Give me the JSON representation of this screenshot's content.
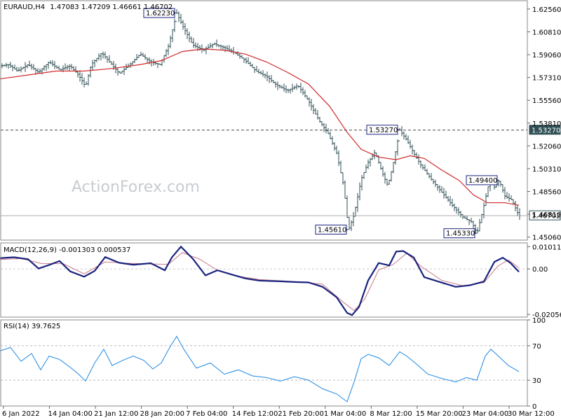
{
  "chart_data": [
    {
      "type": "candlestick-ohlc",
      "panel": "price",
      "symbol": "EURAUD,H4",
      "header_values": "1.47083 1.47209 1.46661 1.46702",
      "watermark": "ActionForex.com",
      "ylim": [
        1.4483,
        1.632
      ],
      "y_ticks": [
        "1.62560",
        "1.60810",
        "1.59060",
        "1.57310",
        "1.55560",
        "1.53810",
        "1.52060",
        "1.50310",
        "1.48560",
        "1.46810",
        "1.45060"
      ],
      "x_ticks": [
        "6 Jan 2022",
        "14 Jan 04:00",
        "21 Jan 12:00",
        "28 Jan 20:00",
        "7 Feb 04:00",
        "14 Feb 12:00",
        "21 Feb 20:00",
        "1 Mar 04:00",
        "8 Mar 12:00",
        "15 Mar 20:00",
        "23 Mar 04:00",
        "30 Mar 12:00"
      ],
      "price_path": [
        [
          0,
          1.582
        ],
        [
          12,
          1.583
        ],
        [
          25,
          1.578
        ],
        [
          40,
          1.583
        ],
        [
          55,
          1.577
        ],
        [
          70,
          1.585
        ],
        [
          85,
          1.579
        ],
        [
          100,
          1.582
        ],
        [
          112,
          1.575
        ],
        [
          122,
          1.566
        ],
        [
          130,
          1.583
        ],
        [
          145,
          1.592
        ],
        [
          158,
          1.584
        ],
        [
          170,
          1.576
        ],
        [
          185,
          1.583
        ],
        [
          200,
          1.591
        ],
        [
          215,
          1.585
        ],
        [
          228,
          1.583
        ],
        [
          240,
          1.597
        ],
        [
          252,
          1.6223
        ],
        [
          262,
          1.611
        ],
        [
          275,
          1.598
        ],
        [
          290,
          1.594
        ],
        [
          305,
          1.599
        ],
        [
          320,
          1.596
        ],
        [
          335,
          1.592
        ],
        [
          350,
          1.586
        ],
        [
          365,
          1.578
        ],
        [
          380,
          1.574
        ],
        [
          395,
          1.567
        ],
        [
          410,
          1.563
        ],
        [
          425,
          1.567
        ],
        [
          440,
          1.555
        ],
        [
          455,
          1.54
        ],
        [
          468,
          1.53
        ],
        [
          480,
          1.515
        ],
        [
          490,
          1.49
        ],
        [
          497,
          1.4561
        ],
        [
          505,
          1.468
        ],
        [
          515,
          1.495
        ],
        [
          525,
          1.508
        ],
        [
          535,
          1.516
        ],
        [
          545,
          1.5
        ],
        [
          553,
          1.49
        ],
        [
          560,
          1.505
        ],
        [
          570,
          1.5327
        ],
        [
          580,
          1.525
        ],
        [
          590,
          1.515
        ],
        [
          600,
          1.506
        ],
        [
          615,
          1.495
        ],
        [
          630,
          1.485
        ],
        [
          645,
          1.475
        ],
        [
          660,
          1.466
        ],
        [
          673,
          1.462
        ],
        [
          680,
          1.4533
        ],
        [
          688,
          1.47
        ],
        [
          698,
          1.494
        ],
        [
          705,
          1.489
        ],
        [
          712,
          1.494
        ],
        [
          720,
          1.482
        ],
        [
          730,
          1.479
        ],
        [
          740,
          1.467
        ]
      ],
      "series": [
        {
          "name": "MA",
          "color": "#d0292b",
          "points": [
            [
              0,
              1.572
            ],
            [
              40,
              1.575
            ],
            [
              80,
              1.578
            ],
            [
              120,
              1.578
            ],
            [
              160,
              1.58
            ],
            [
              200,
              1.583
            ],
            [
              230,
              1.586
            ],
            [
              260,
              1.593
            ],
            [
              290,
              1.595
            ],
            [
              320,
              1.594
            ],
            [
              350,
              1.591
            ],
            [
              380,
              1.585
            ],
            [
              410,
              1.577
            ],
            [
              440,
              1.568
            ],
            [
              470,
              1.551
            ],
            [
              495,
              1.531
            ],
            [
              515,
              1.518
            ],
            [
              540,
              1.512
            ],
            [
              565,
              1.51
            ],
            [
              585,
              1.513
            ],
            [
              605,
              1.511
            ],
            [
              630,
              1.502
            ],
            [
              655,
              1.494
            ],
            [
              675,
              1.483
            ],
            [
              695,
              1.477
            ],
            [
              720,
              1.477
            ],
            [
              740,
              1.475
            ]
          ]
        }
      ],
      "horizontal_lines": [
        {
          "value": 1.5327,
          "label": "1.53270",
          "style": "dashed"
        },
        {
          "value": 1.46702,
          "label": "1.46702",
          "style": "solid"
        }
      ],
      "annotations": [
        {
          "text": "1.62230",
          "value": 1.6223,
          "bar": 252
        },
        {
          "text": "1.53270",
          "value": 1.5327,
          "bar": 570
        },
        {
          "text": "1.49400",
          "value": 1.494,
          "bar": 712
        },
        {
          "text": "1.45610",
          "value": 1.4561,
          "bar": 497
        },
        {
          "text": "1.45330",
          "value": 1.4533,
          "bar": 680
        }
      ]
    },
    {
      "type": "line",
      "panel": "macd",
      "title": "MACD(12,26,9) -0.001303 0.000537",
      "ylim": [
        -0.0218,
        0.0118
      ],
      "y_ticks": [
        "0.010113",
        "0.00",
        "-0.020561"
      ],
      "series": [
        {
          "name": "MACD",
          "color": "#1a237e",
          "points": [
            [
              0,
              0.0049
            ],
            [
              20,
              0.0053
            ],
            [
              40,
              0.0044
            ],
            [
              55,
              0.0002
            ],
            [
              70,
              0.0018
            ],
            [
              85,
              0.0036
            ],
            [
              100,
              -0.0011
            ],
            [
              120,
              -0.0035
            ],
            [
              135,
              -0.0009
            ],
            [
              150,
              0.0054
            ],
            [
              170,
              0.0028
            ],
            [
              190,
              0.0019
            ],
            [
              215,
              0.0026
            ],
            [
              235,
              -0.0006
            ],
            [
              245,
              0.0052
            ],
            [
              258,
              0.0101
            ],
            [
              275,
              0.0046
            ],
            [
              293,
              -0.0029
            ],
            [
              310,
              -0.0006
            ],
            [
              330,
              -0.0025
            ],
            [
              350,
              -0.0043
            ],
            [
              370,
              -0.0053
            ],
            [
              400,
              -0.0056
            ],
            [
              420,
              -0.0059
            ],
            [
              440,
              -0.0061
            ],
            [
              460,
              -0.0081
            ],
            [
              480,
              -0.0128
            ],
            [
              495,
              -0.0199
            ],
            [
              502,
              -0.0209
            ],
            [
              512,
              -0.0172
            ],
            [
              525,
              -0.0052
            ],
            [
              540,
              0.0027
            ],
            [
              555,
              0.0016
            ],
            [
              565,
              0.0079
            ],
            [
              575,
              0.0081
            ],
            [
              590,
              0.0052
            ],
            [
              605,
              -0.0037
            ],
            [
              625,
              -0.0057
            ],
            [
              650,
              -0.0081
            ],
            [
              670,
              -0.0074
            ],
            [
              690,
              -0.0057
            ],
            [
              705,
              0.0032
            ],
            [
              717,
              0.0051
            ],
            [
              728,
              0.0027
            ],
            [
              740,
              -0.0013
            ]
          ]
        },
        {
          "name": "Signal",
          "color": "#c87a8a",
          "points": [
            [
              0,
              0.0043
            ],
            [
              30,
              0.0047
            ],
            [
              60,
              0.0024
            ],
            [
              90,
              0.0024
            ],
            [
              120,
              -0.0022
            ],
            [
              150,
              0.0032
            ],
            [
              180,
              0.0026
            ],
            [
              210,
              0.0023
            ],
            [
              240,
              0.0021
            ],
            [
              260,
              0.0074
            ],
            [
              285,
              0.0044
            ],
            [
              310,
              -0.0006
            ],
            [
              340,
              -0.0033
            ],
            [
              370,
              -0.0048
            ],
            [
              420,
              -0.0057
            ],
            [
              460,
              -0.0069
            ],
            [
              490,
              -0.0152
            ],
            [
              505,
              -0.0188
            ],
            [
              520,
              -0.0137
            ],
            [
              540,
              -0.0004
            ],
            [
              560,
              0.0019
            ],
            [
              580,
              0.0071
            ],
            [
              600,
              0.0013
            ],
            [
              630,
              -0.0052
            ],
            [
              660,
              -0.0076
            ],
            [
              690,
              -0.0062
            ],
            [
              710,
              0.0013
            ],
            [
              725,
              0.0041
            ],
            [
              740,
              0.0005
            ]
          ]
        }
      ]
    },
    {
      "type": "line",
      "panel": "rsi",
      "title": "RSI(14) 39.7625",
      "ylim": [
        0,
        100
      ],
      "y_ticks": [
        "100",
        "70",
        "30",
        "0"
      ],
      "levels": [
        70,
        30
      ],
      "series": [
        {
          "name": "RSI",
          "color": "#1e88e5",
          "points": [
            [
              0,
              64
            ],
            [
              15,
              68
            ],
            [
              30,
              52
            ],
            [
              45,
              61
            ],
            [
              58,
              42
            ],
            [
              70,
              58
            ],
            [
              85,
              54
            ],
            [
              100,
              45
            ],
            [
              112,
              37
            ],
            [
              122,
              29
            ],
            [
              135,
              50
            ],
            [
              148,
              66
            ],
            [
              160,
              47
            ],
            [
              175,
              53
            ],
            [
              190,
              58
            ],
            [
              205,
              53
            ],
            [
              218,
              43
            ],
            [
              230,
              50
            ],
            [
              242,
              68
            ],
            [
              252,
              81
            ],
            [
              262,
              66
            ],
            [
              280,
              44
            ],
            [
              300,
              50
            ],
            [
              320,
              37
            ],
            [
              340,
              42
            ],
            [
              360,
              35
            ],
            [
              380,
              33
            ],
            [
              400,
              29
            ],
            [
              420,
              34
            ],
            [
              440,
              30
            ],
            [
              460,
              20
            ],
            [
              480,
              14
            ],
            [
              495,
              5
            ],
            [
              505,
              28
            ],
            [
              515,
              55
            ],
            [
              525,
              60
            ],
            [
              540,
              56
            ],
            [
              555,
              47
            ],
            [
              570,
              63
            ],
            [
              580,
              58
            ],
            [
              595,
              48
            ],
            [
              610,
              37
            ],
            [
              630,
              32
            ],
            [
              650,
              28
            ],
            [
              665,
              33
            ],
            [
              680,
              30
            ],
            [
              692,
              58
            ],
            [
              700,
              66
            ],
            [
              712,
              57
            ],
            [
              725,
              47
            ],
            [
              740,
              40
            ]
          ]
        }
      ]
    }
  ]
}
